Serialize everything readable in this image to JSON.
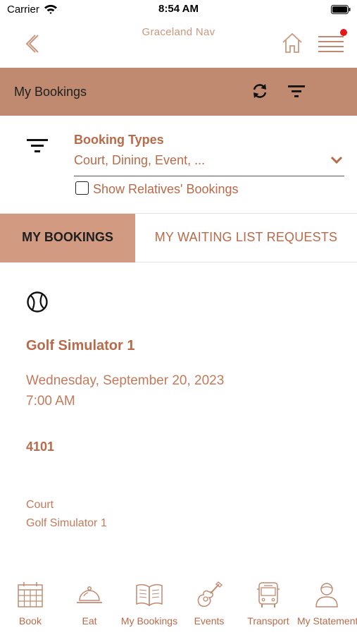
{
  "status_bar": {
    "carrier": "Carrier",
    "time": "8:54 AM"
  },
  "nav": {
    "title": "Graceland Nav"
  },
  "header": {
    "title": "My Bookings"
  },
  "filter": {
    "booking_types_label": "Booking Types",
    "booking_types_value": "Court, Dining, Event, ...",
    "relatives_label": "Show Relatives' Bookings",
    "relatives_checked": false
  },
  "tabs": [
    {
      "label": "MY BOOKINGS",
      "active": true
    },
    {
      "label": "MY WAITING LIST REQUESTS",
      "active": false
    }
  ],
  "booking": {
    "name": "Golf Simulator 1",
    "date": "Wednesday, September 20, 2023",
    "time": "7:00 AM",
    "number": "4101",
    "category": "Court",
    "facility": "Golf Simulator 1"
  },
  "bottom_tabs": [
    {
      "label": "Book",
      "icon": "calendar-grid-icon"
    },
    {
      "label": "Eat",
      "icon": "cloche-icon"
    },
    {
      "label": "My Bookings",
      "icon": "open-book-icon"
    },
    {
      "label": "Events",
      "icon": "guitar-icon"
    },
    {
      "label": "Transport",
      "icon": "bus-icon"
    },
    {
      "label": "My Statement",
      "icon": "person-icon"
    }
  ],
  "colors": {
    "accent": "#b86a49",
    "header_band": "#c08a70",
    "active_tab": "#d29a80",
    "notification_dot": "#e8161b"
  }
}
